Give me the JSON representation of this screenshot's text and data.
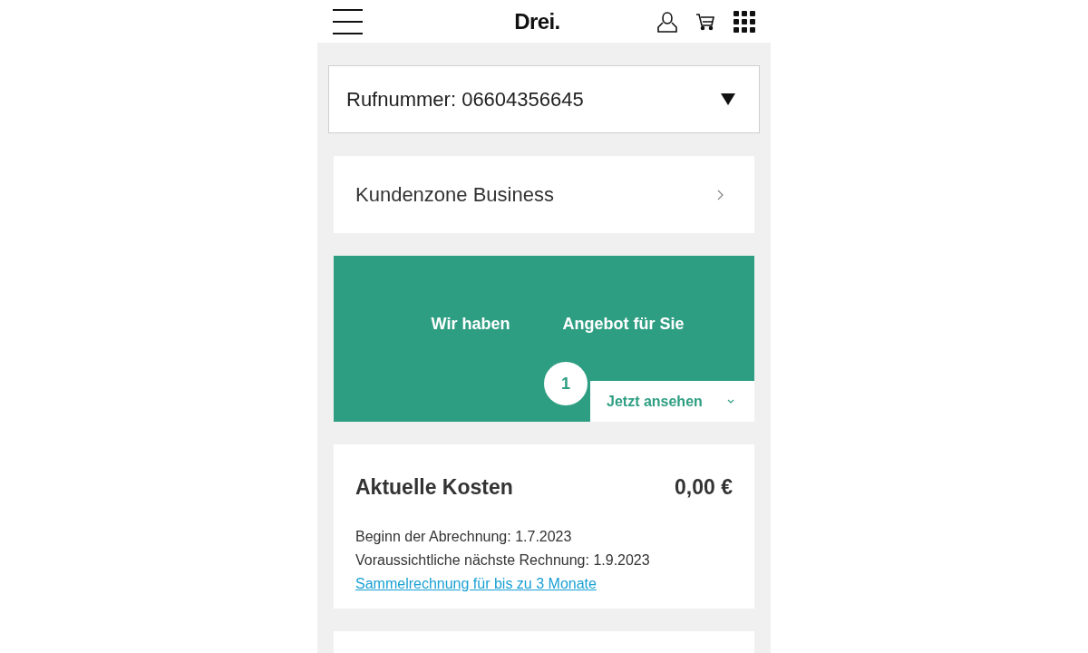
{
  "header": {
    "logo": "Drei."
  },
  "number_select": {
    "value": "Rufnummer: 06604356645"
  },
  "kundenzone": {
    "label": "Kundenzone Business"
  },
  "offer": {
    "text_left": "Wir haben",
    "text_right": "Angebot für Sie",
    "count": "1",
    "button": "Jetzt ansehen"
  },
  "costs": {
    "title": "Aktuelle Kosten",
    "amount": "0,00 €",
    "lines": [
      "Beginn der Abrechnung: 1.7.2023",
      "Voraussichtliche nächste Rechnung: 1.9.2023"
    ],
    "link": "Sammelrechnung für bis zu 3 Monate"
  }
}
